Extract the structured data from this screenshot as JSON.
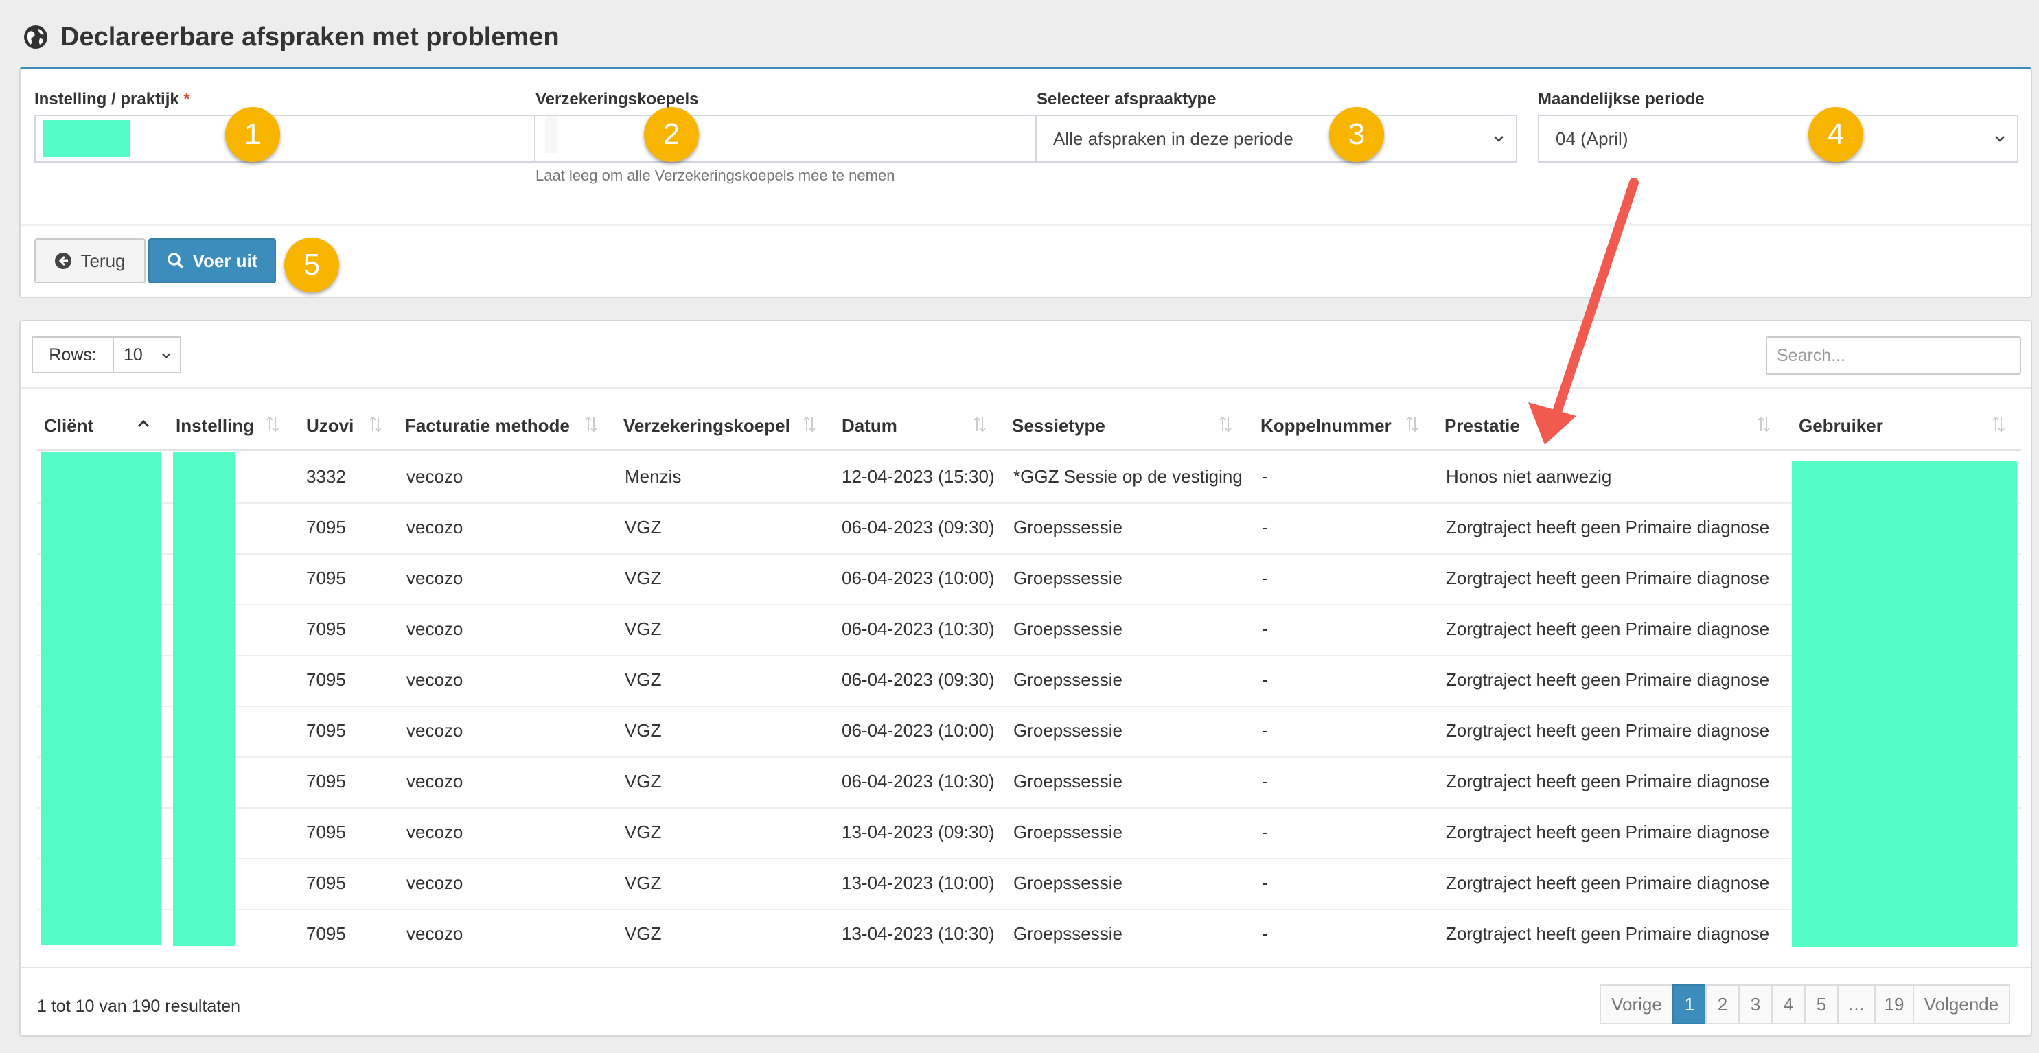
{
  "page": {
    "title": "Declareerbare afspraken met problemen"
  },
  "filters": {
    "instelling_label": "Instelling / praktijk",
    "required_mark": "*",
    "koepel_label": "Verzekeringskoepels",
    "koepel_help": "Laat leeg om alle Verzekeringskoepels mee te nemen",
    "type_label": "Selecteer afspraaktype",
    "type_value": "Alle afspraken in deze periode",
    "period_label": "Maandelijkse periode",
    "period_value": "04 (April)",
    "back_label": "Terug",
    "run_label": "Voer uit"
  },
  "badges": [
    "1",
    "2",
    "3",
    "4",
    "5"
  ],
  "table": {
    "rows_label": "Rows:",
    "rows_value": "10",
    "search_placeholder": "Search...",
    "columns": [
      "Cliënt",
      "Instelling",
      "Uzovi",
      "Facturatie methode",
      "Verzekeringskoepel",
      "Datum",
      "Sessietype",
      "Koppelnummer",
      "Prestatie",
      "Gebruiker"
    ],
    "rows": [
      {
        "uzovi": "3332",
        "methode": "vecozo",
        "koepel": "Menzis",
        "datum": "12-04-2023 (15:30)",
        "sessie": "*GGZ Sessie op de vestiging",
        "koppel": "-",
        "prestatie": "Honos niet aanwezig"
      },
      {
        "uzovi": "7095",
        "methode": "vecozo",
        "koepel": "VGZ",
        "datum": "06-04-2023 (09:30)",
        "sessie": "Groepssessie",
        "koppel": "-",
        "prestatie": "Zorgtraject heeft geen Primaire diagnose"
      },
      {
        "uzovi": "7095",
        "methode": "vecozo",
        "koepel": "VGZ",
        "datum": "06-04-2023 (10:00)",
        "sessie": "Groepssessie",
        "koppel": "-",
        "prestatie": "Zorgtraject heeft geen Primaire diagnose"
      },
      {
        "uzovi": "7095",
        "methode": "vecozo",
        "koepel": "VGZ",
        "datum": "06-04-2023 (10:30)",
        "sessie": "Groepssessie",
        "koppel": "-",
        "prestatie": "Zorgtraject heeft geen Primaire diagnose"
      },
      {
        "uzovi": "7095",
        "methode": "vecozo",
        "koepel": "VGZ",
        "datum": "06-04-2023 (09:30)",
        "sessie": "Groepssessie",
        "koppel": "-",
        "prestatie": "Zorgtraject heeft geen Primaire diagnose"
      },
      {
        "uzovi": "7095",
        "methode": "vecozo",
        "koepel": "VGZ",
        "datum": "06-04-2023 (10:00)",
        "sessie": "Groepssessie",
        "koppel": "-",
        "prestatie": "Zorgtraject heeft geen Primaire diagnose"
      },
      {
        "uzovi": "7095",
        "methode": "vecozo",
        "koepel": "VGZ",
        "datum": "06-04-2023 (10:30)",
        "sessie": "Groepssessie",
        "koppel": "-",
        "prestatie": "Zorgtraject heeft geen Primaire diagnose"
      },
      {
        "uzovi": "7095",
        "methode": "vecozo",
        "koepel": "VGZ",
        "datum": "13-04-2023 (09:30)",
        "sessie": "Groepssessie",
        "koppel": "-",
        "prestatie": "Zorgtraject heeft geen Primaire diagnose"
      },
      {
        "uzovi": "7095",
        "methode": "vecozo",
        "koepel": "VGZ",
        "datum": "13-04-2023 (10:00)",
        "sessie": "Groepssessie",
        "koppel": "-",
        "prestatie": "Zorgtraject heeft geen Primaire diagnose"
      },
      {
        "uzovi": "7095",
        "methode": "vecozo",
        "koepel": "VGZ",
        "datum": "13-04-2023 (10:30)",
        "sessie": "Groepssessie",
        "koppel": "-",
        "prestatie": "Zorgtraject heeft geen Primaire diagnose"
      }
    ],
    "results_info": "1 tot 10 van 190 resultaten",
    "pagination": [
      "Vorige",
      "1",
      "2",
      "3",
      "4",
      "5",
      "…",
      "19",
      "Volgende"
    ],
    "active_page": "1"
  },
  "colors": {
    "accent": "#3c8dbc",
    "badge": "#f7b500",
    "redaction": "#55fbc7",
    "annotation_arrow": "#f25a4f"
  },
  "icons": [
    "globe-icon",
    "arrow-circle-left-icon",
    "search-icon",
    "chevron-down-icon",
    "sort-icon",
    "sort-up-icon"
  ]
}
